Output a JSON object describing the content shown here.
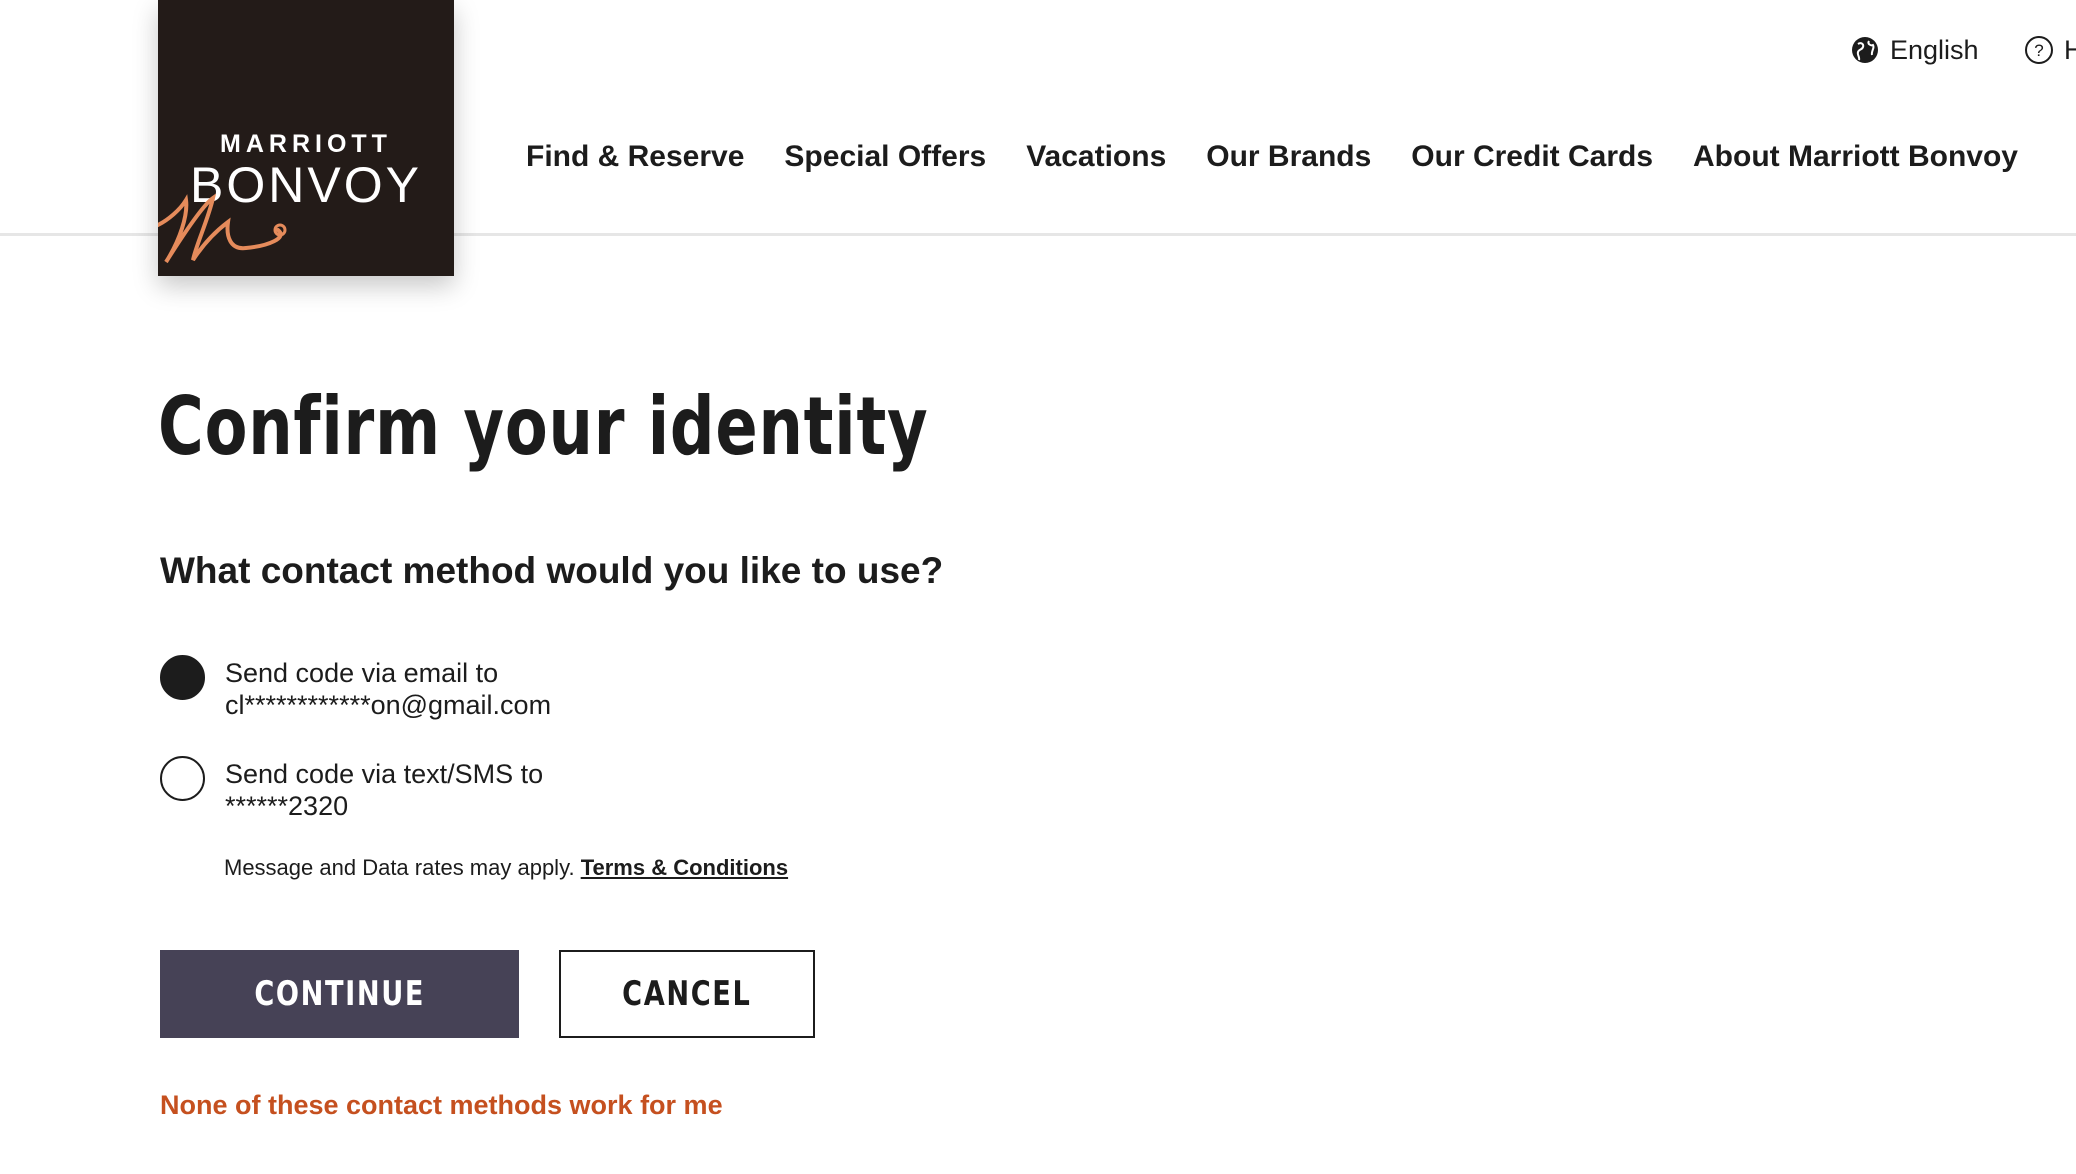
{
  "brand": {
    "top": "MARRIOTT",
    "main": "BONVOY",
    "bg_color": "#231b18",
    "accent_color": "#e58b5b"
  },
  "utility": {
    "language_label": "English",
    "language_icon": "globe-icon",
    "help_label": "H",
    "help_icon": "question-circle-icon"
  },
  "nav": {
    "items": [
      {
        "label": "Find & Reserve"
      },
      {
        "label": "Special Offers"
      },
      {
        "label": "Vacations"
      },
      {
        "label": "Our Brands"
      },
      {
        "label": "Our Credit Cards"
      },
      {
        "label": "About Marriott Bonvoy"
      }
    ]
  },
  "main": {
    "title": "Confirm your identity",
    "question": "What contact method would you like to use?",
    "options": [
      {
        "line1": "Send code via email to",
        "line2": "cl************on@gmail.com",
        "selected": true
      },
      {
        "line1": "Send code via text/SMS to",
        "line2": "******2320",
        "selected": false
      }
    ],
    "disclaimer_text": "Message and Data rates may apply.",
    "terms_link": "Terms & Conditions",
    "continue_label": "CONTINUE",
    "cancel_label": "CANCEL",
    "alt_link": "None of these contact methods work for me",
    "colors": {
      "primary_button": "#464256",
      "link_accent": "#c5501f"
    }
  }
}
